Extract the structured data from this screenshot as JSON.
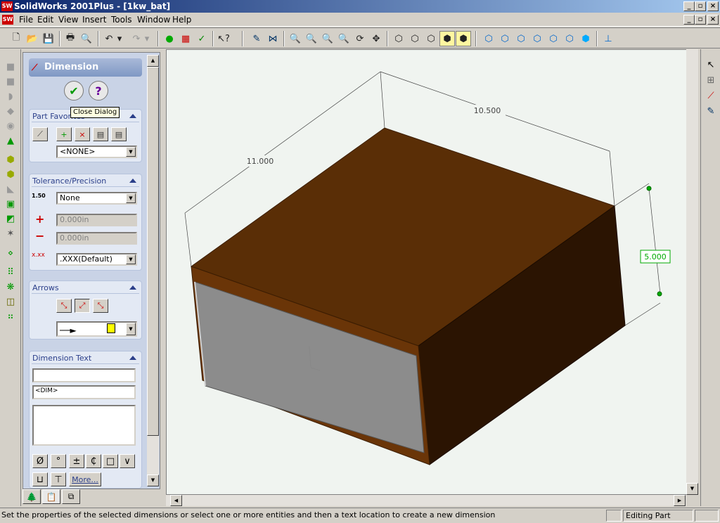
{
  "window": {
    "title": "SolidWorks 2001Plus - [1kw_bat]",
    "app_icon": "SW"
  },
  "menu": [
    "File",
    "Edit",
    "View",
    "Insert",
    "Tools",
    "Window",
    "Help"
  ],
  "panel": {
    "title": "Dimension",
    "tooltip": "Close Dialog",
    "part_favorites": {
      "title": "Part Favorites",
      "combo": "<NONE>"
    },
    "tolerance": {
      "title": "Tolerance/Precision",
      "icon_label": "1.50",
      "type": "None",
      "plus": "0.000in",
      "minus": "0.000in",
      "precision": ".XXX(Default)"
    },
    "arrows": {
      "title": "Arrows"
    },
    "dim_text": {
      "title": "Dimension Text",
      "line2": "<DIM>",
      "more": "More..."
    }
  },
  "symbols": [
    "Ø",
    "°",
    "±",
    "₵",
    "□",
    "∨",
    "⊔",
    "⊤"
  ],
  "model": {
    "dim1": "10.500",
    "dim2": "11.000",
    "dim3": "5.000",
    "top_color": "#5a2e06",
    "side_color": "#2b1402",
    "face_color": "#8c8c8c"
  },
  "status": {
    "message": "Set the properties of the selected dimensions or select one or more entities and then a text location to create a new dimension",
    "mode": "Editing Part"
  }
}
